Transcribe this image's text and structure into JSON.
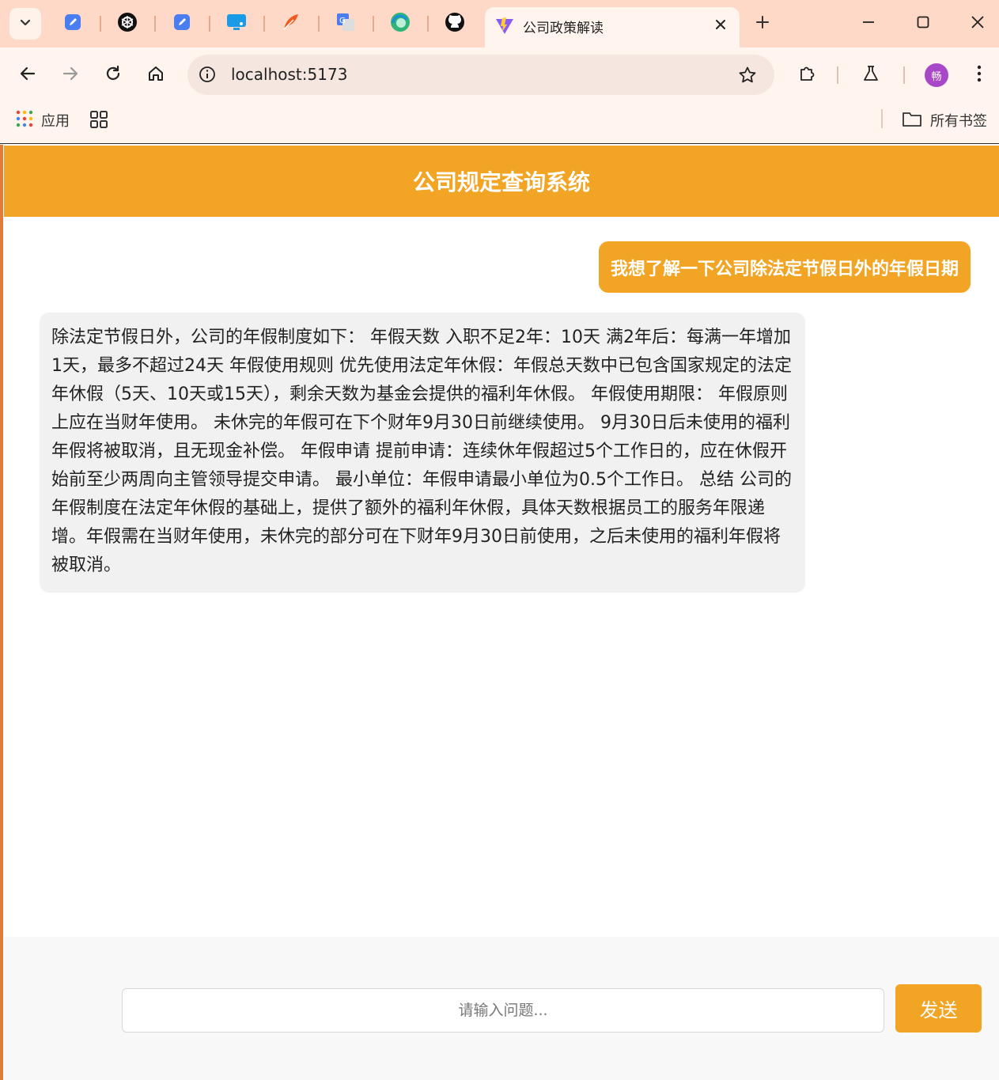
{
  "browser": {
    "active_tab_title": "公司政策解读",
    "url": "localhost:5173",
    "avatar_text": "畅",
    "bookmarks": {
      "apps_label": "应用",
      "all_bookmarks_label": "所有书签"
    },
    "pinned_tabs": [
      "docs-icon",
      "chatgpt-icon",
      "docs-icon",
      "remote-desktop-icon",
      "feather-icon",
      "translate-icon",
      "edge-icon",
      "github-icon"
    ]
  },
  "app": {
    "title": "公司规定查询系统",
    "accent_color": "#f2a424"
  },
  "chat": {
    "user_message": "我想了解一下公司除法定节假日外的年假日期",
    "bot_message": "除法定节假日外，公司的年假制度如下： 年假天数 入职不足2年：10天 满2年后：每满一年增加1天，最多不超过24天 年假使用规则 优先使用法定年休假：年假总天数中已包含国家规定的法定年休假（5天、10天或15天），剩余天数为基金会提供的福利年休假。 年假使用期限： 年假原则上应在当财年使用。 未休完的年假可在下个财年9月30日前继续使用。 9月30日后未使用的福利年假将被取消，且无现金补偿。 年假申请 提前申请：连续休年假超过5个工作日的，应在休假开始前至少两周向主管领导提交申请。 最小单位：年假申请最小单位为0.5个工作日。 总结 公司的年假制度在法定年休假的基础上，提供了额外的福利年休假，具体天数根据员工的服务年限递增。年假需在当财年使用，未休完的部分可在下财年9月30日前使用，之后未使用的福利年假将被取消。"
  },
  "input": {
    "placeholder": "请输入问题...",
    "value": "",
    "send_label": "发送"
  }
}
